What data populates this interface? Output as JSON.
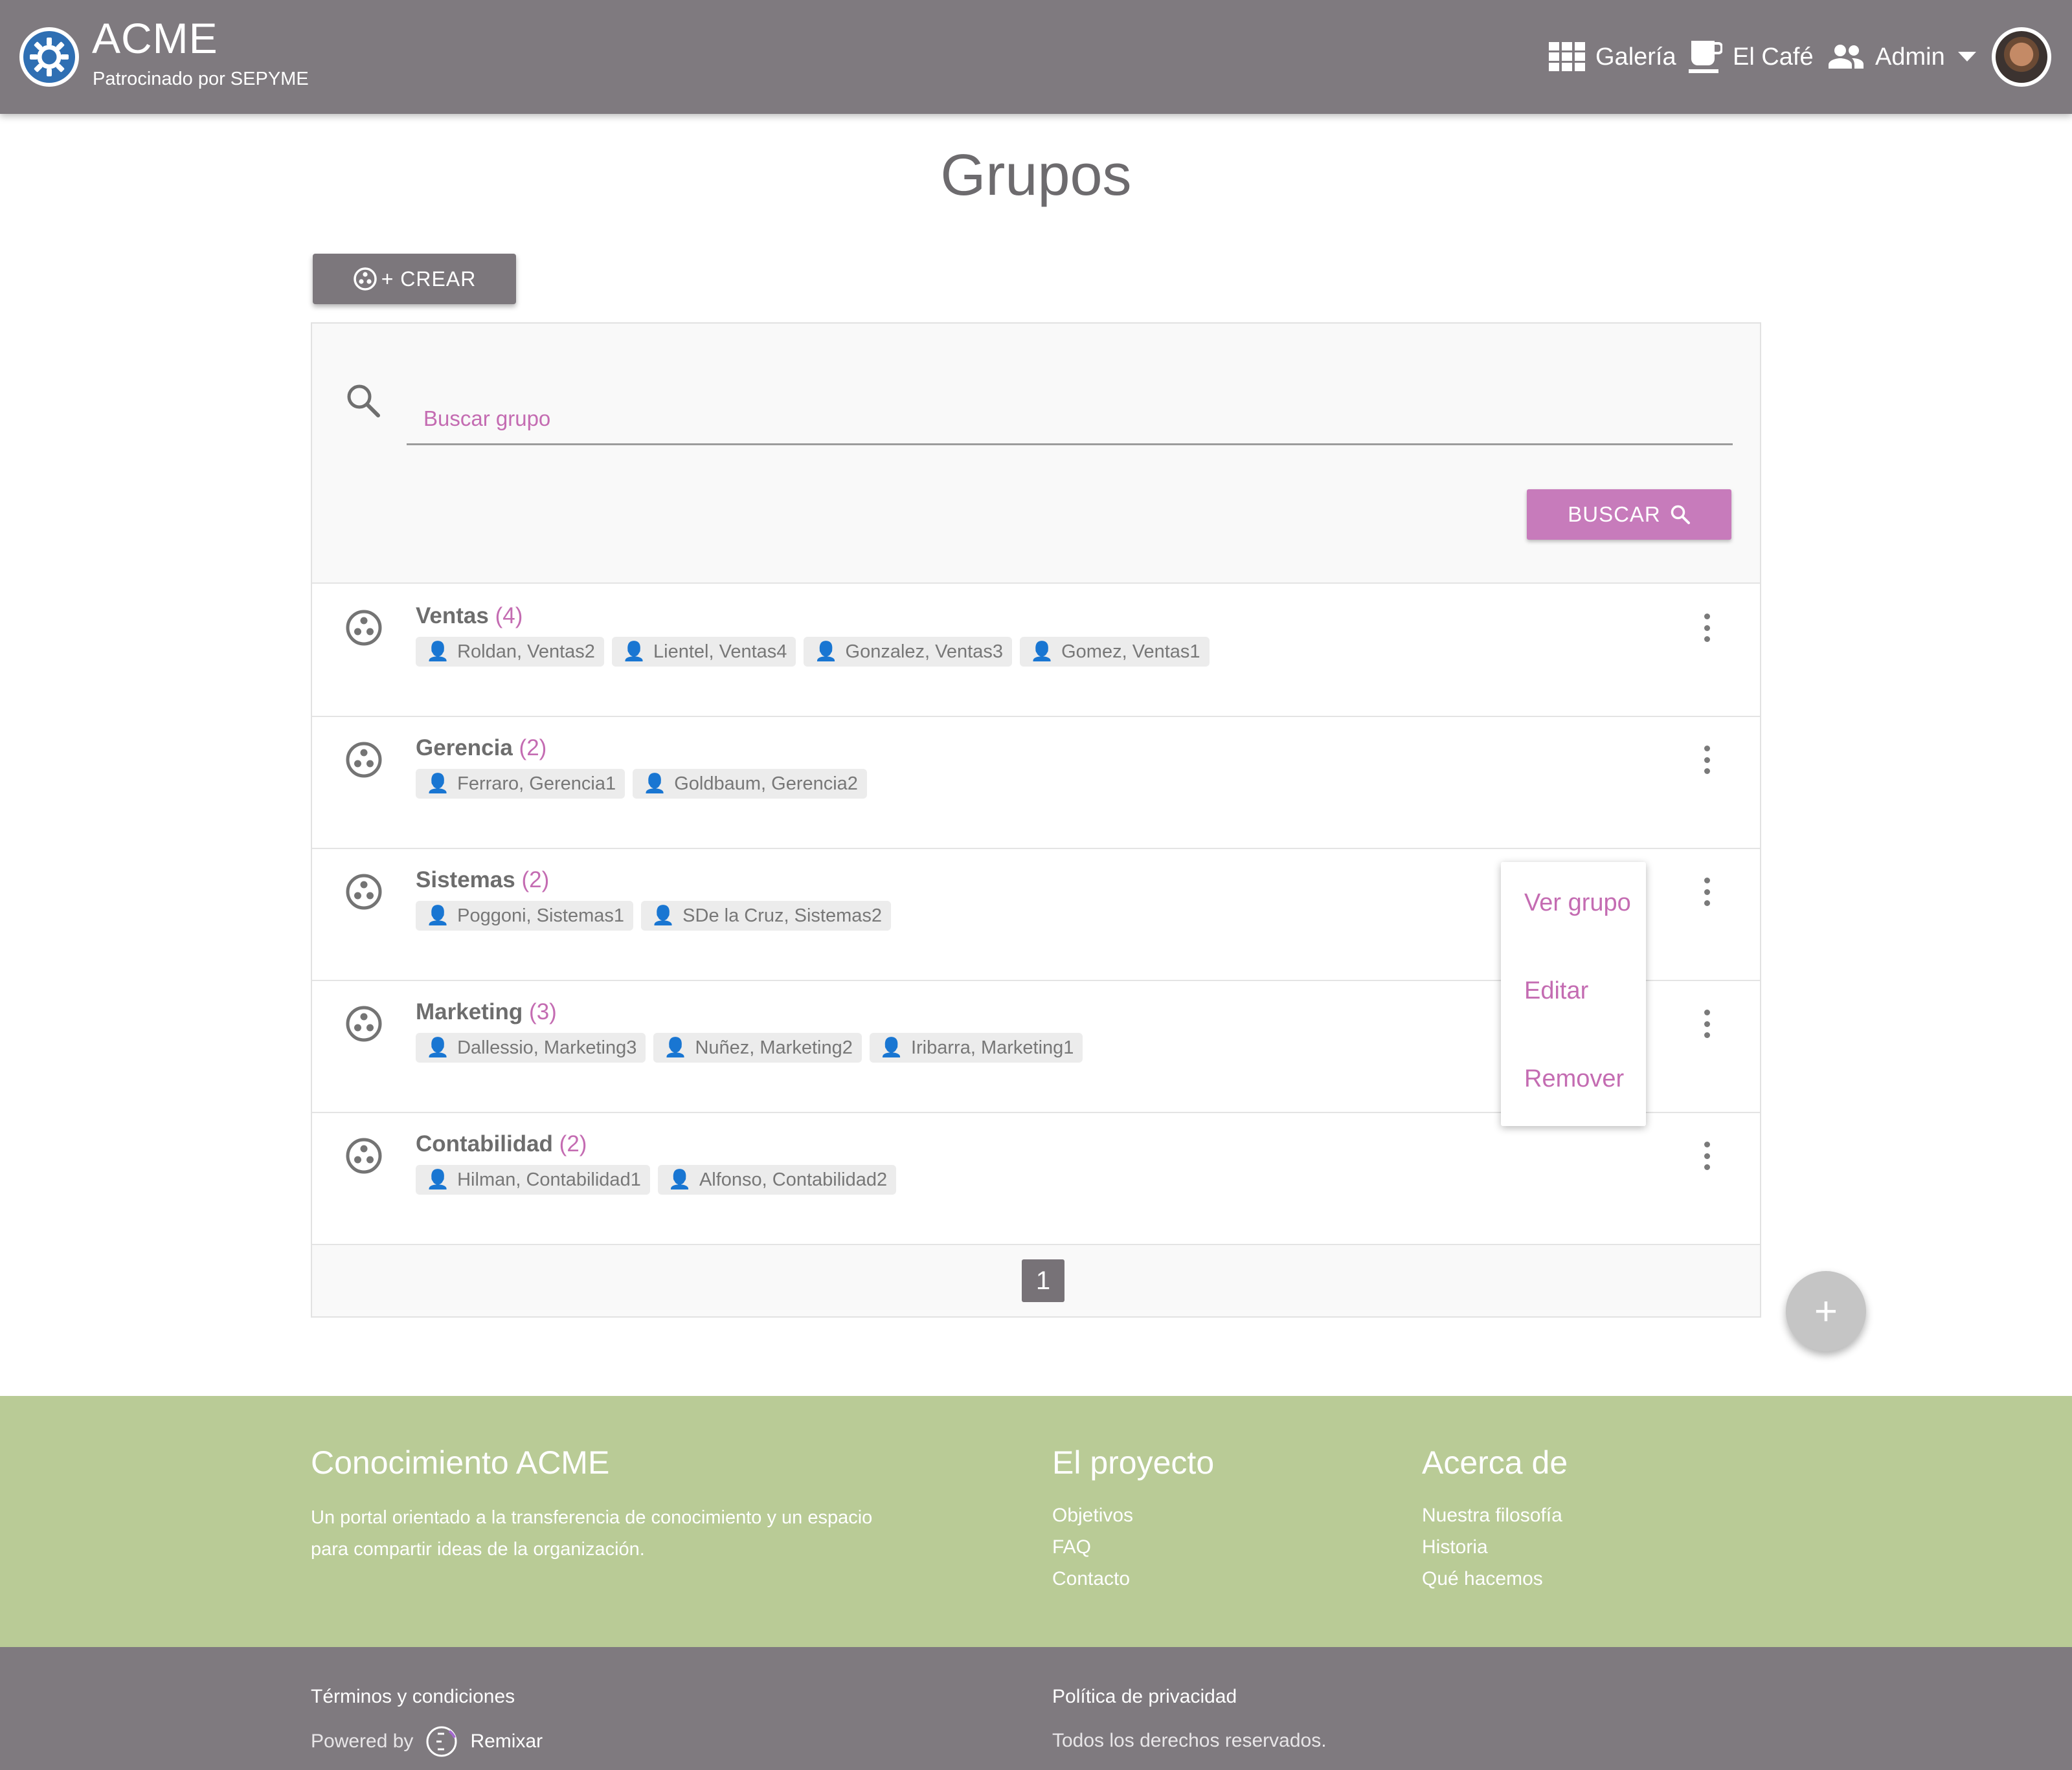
{
  "header": {
    "brand": "ACME",
    "subtitle": "Patrocinado por SEPYME",
    "nav": [
      {
        "label": "Galería",
        "icon": "grid-icon"
      },
      {
        "label": "El Café",
        "icon": "coffee-icon"
      },
      {
        "label": "Admin",
        "icon": "people-icon"
      }
    ]
  },
  "page": {
    "title": "Grupos",
    "create_label": "+ CREAR",
    "search_placeholder": "Buscar grupo",
    "search_button": "BUSCAR"
  },
  "groups": [
    {
      "name": "Ventas",
      "count": "(4)",
      "members": [
        "Roldan, Ventas2",
        "Lientel, Ventas4",
        "Gonzalez, Ventas3",
        "Gomez, Ventas1"
      ]
    },
    {
      "name": "Gerencia",
      "count": "(2)",
      "members": [
        "Ferraro, Gerencia1",
        "Goldbaum, Gerencia2"
      ]
    },
    {
      "name": "Sistemas",
      "count": "(2)",
      "members": [
        "Poggoni, Sistemas1",
        "SDe la Cruz, Sistemas2"
      ]
    },
    {
      "name": "Marketing",
      "count": "(3)",
      "members": [
        "Dallessio, Marketing3",
        "Nuñez, Marketing2",
        "Iribarra, Marketing1"
      ]
    },
    {
      "name": "Contabilidad",
      "count": "(2)",
      "members": [
        "Hilman, Contabilidad1",
        "Alfonso, Contabilidad2"
      ]
    }
  ],
  "context_menu": [
    "Ver grupo",
    "Editar",
    "Remover"
  ],
  "pagination": {
    "current": "1"
  },
  "fab_label": "+",
  "footer": {
    "about_title": "Conocimiento ACME",
    "about_text_1": "Un portal orientado a la transferencia de conocimiento y un espacio",
    "about_text_2": "para compartir ideas de la organización.",
    "project_title": "El proyecto",
    "project_links": [
      "Objetivos",
      "FAQ",
      "Contacto"
    ],
    "acerca_title": "Acerca de",
    "acerca_links": [
      "Nuestra filosofía",
      "Historia",
      "Qué hacemos"
    ],
    "terms": "Términos y condiciones",
    "privacy": "Política de privacidad",
    "powered_by": "Powered by",
    "powered_name": "Remixar",
    "rights": "Todos los derechos reservados."
  },
  "colors": {
    "header": "#7f7a7f",
    "accent": "#c77bbb",
    "footer_green": "#b9cb96"
  }
}
